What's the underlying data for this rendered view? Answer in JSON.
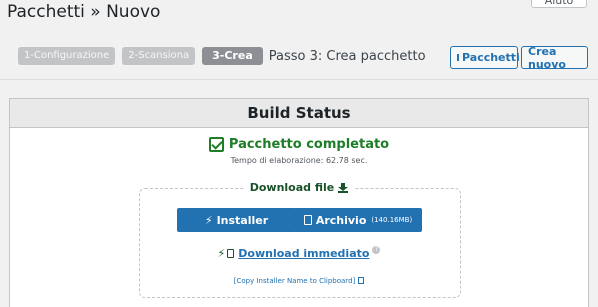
{
  "header": {
    "title": "Pacchetti » Nuovo",
    "help_label": "Aiuto"
  },
  "steps": [
    {
      "label": "1-Configurazione",
      "state": "done"
    },
    {
      "label": "2-Scansiona",
      "state": "done"
    },
    {
      "label": "3-Crea",
      "state": "active"
    }
  ],
  "step_text": "Passo 3: Crea pacchetto",
  "toolbar": {
    "pacchetti_label": "Pacchetti",
    "crea_label": "Crea nuovo"
  },
  "panel": {
    "title": "Build Status",
    "status": "Pacchetto completato",
    "elapsed": "Tempo di elaborazione: 62.78 sec.",
    "download_title": "Download file",
    "installer_label": "Installer",
    "archivio_label": "Archivio",
    "archivio_size": "(140.16MB)",
    "immediate_label": "Download immediato",
    "copy_label": "[Copy Installer Name to Clipboard]"
  },
  "colors": {
    "accent": "#2271b1",
    "success": "#1e7d27",
    "download_green": "#1a5228"
  }
}
